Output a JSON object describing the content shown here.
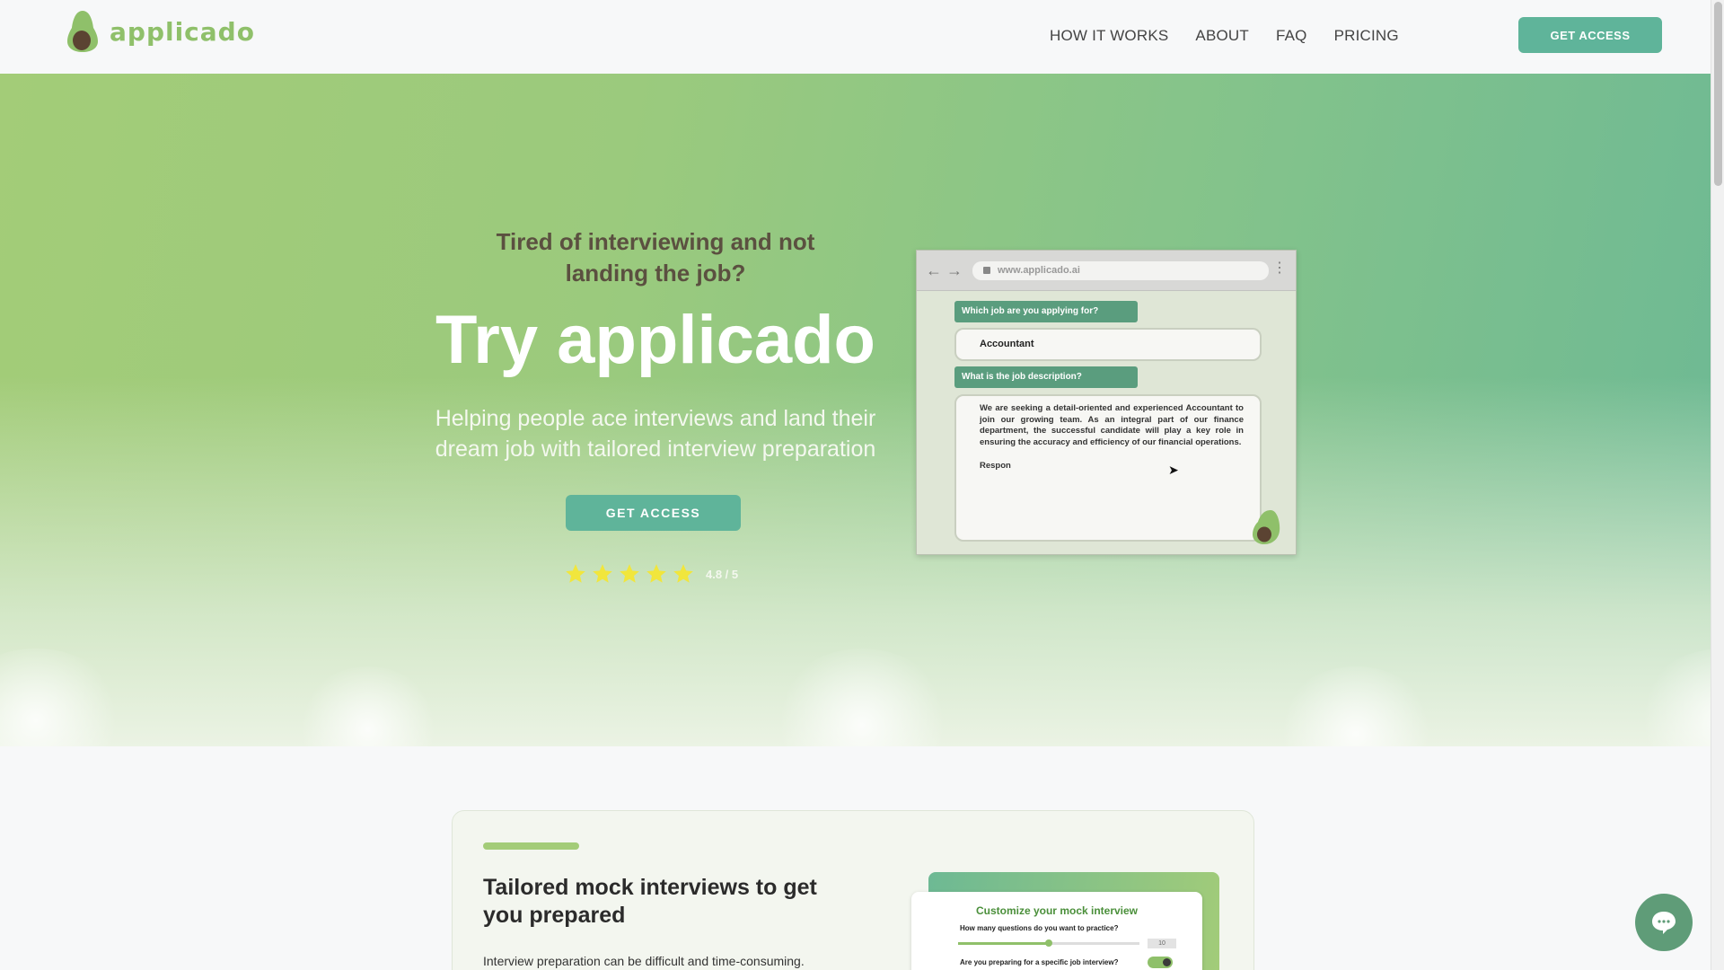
{
  "header": {
    "logo_text": "applicado",
    "nav": [
      "HOW IT WORKS",
      "ABOUT",
      "FAQ",
      "PRICING"
    ],
    "cta_label": "GET ACCESS"
  },
  "hero": {
    "tagline": "Tired of interviewing and not landing the job?",
    "title": "Try applicado",
    "subtitle": "Helping people ace interviews and land their dream job with tailored interview preparation",
    "cta_label": "GET ACCESS",
    "rating": {
      "stars": 5,
      "text": "4.8 / 5"
    }
  },
  "browser_mock": {
    "url": "www.applicado.ai",
    "question_1": "Which job are you applying for?",
    "answer_1": "Accountant",
    "question_2": "What is the job description?",
    "answer_2_p1": "We are seeking a detail-oriented and experienced Accountant to join our growing team. As an integral part of our finance department, the successful candidate will play a key role in ensuring the accuracy and efficiency of our financial operations.",
    "answer_2_p2": "Respon"
  },
  "feature_card": {
    "title": "Tailored mock interviews to get you prepared",
    "text": "Interview preparation can be difficult and time-consuming.",
    "mock": {
      "title": "Customize your mock interview",
      "question_count_label": "How many questions do you want to practice?",
      "question_count_value": "10",
      "question_count_fraction": 0.5,
      "specific_job_label": "Are you preparing for a specific job interview?",
      "specific_job_enabled": true
    }
  },
  "colors": {
    "brand_green": "#8fc06a",
    "button_teal": "#5fb49a",
    "star_yellow": "#f1e63c"
  }
}
